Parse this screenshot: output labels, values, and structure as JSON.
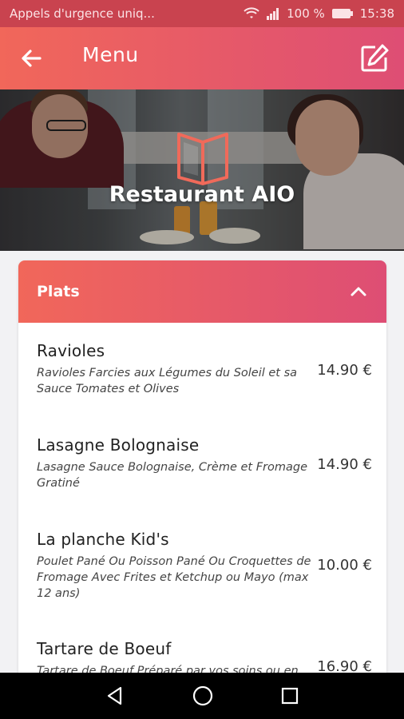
{
  "status_bar": {
    "notification_text": "Appels d'urgence uniq...",
    "battery_percent": "100 %",
    "time": "15:38",
    "icons": [
      "wifi-icon",
      "signal-icon",
      "battery-icon"
    ]
  },
  "app_bar": {
    "title": "Menu",
    "back_icon": "arrow-left-icon",
    "edit_icon": "edit-icon"
  },
  "hero": {
    "restaurant_name": "Restaurant AIO",
    "logo_icon": "open-book-icon"
  },
  "section": {
    "title": "Plats",
    "toggle_icon": "chevron-up-icon",
    "items": [
      {
        "name": "Ravioles",
        "description": "Ravioles Farcies aux Légumes du Soleil et sa Sauce Tomates et Olives",
        "price": "14.90 €"
      },
      {
        "name": "Lasagne Bolognaise",
        "description": "Lasagne Sauce Bolognaise, Crème et Fromage Gratiné",
        "price": "14.90 €"
      },
      {
        "name": "La planche Kid's",
        "description": "Poulet Pané Ou Poisson Pané Ou Croquettes de Fromage Avec Frites et Ketchup ou Mayo (max 12 ans)",
        "price": "10.00 €"
      },
      {
        "name": "Tartare de Boeuf",
        "description": "Tartare de Boeuf Préparé par vos soins ou en",
        "price": "16.90 €"
      }
    ]
  },
  "nav_bar": {
    "icons": [
      "nav-back-icon",
      "nav-home-icon",
      "nav-recents-icon"
    ]
  },
  "colors": {
    "accent_start": "#f1675a",
    "accent_end": "#de4e74",
    "status_bar": "#c9434f"
  }
}
